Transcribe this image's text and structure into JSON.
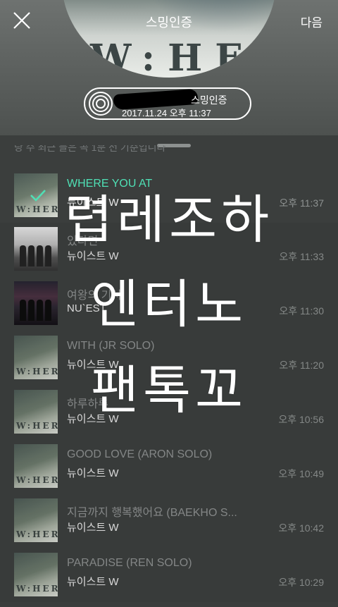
{
  "header": {
    "title": "스밍인증",
    "next_label": "다음",
    "album_art_text": "W:HERE",
    "badge": {
      "label": "스밍인증",
      "timestamp": "2017.11.24 오후 11:37"
    }
  },
  "list": {
    "partial_header_text": "당 수 최근 들은 곡 1분 전 기준입니다",
    "items": [
      {
        "title": "WHERE YOU AT",
        "artist": "뉴이스트 W",
        "time": "오후 11:37",
        "active": true,
        "thumb_text": "W:HERE"
      },
      {
        "title": "있다면",
        "artist": "뉴이스트 W",
        "time": "오후 11:33",
        "active": false,
        "thumb_text": ""
      },
      {
        "title": "여왕의 기사",
        "artist": "NU`EST",
        "time": "오후 11:30",
        "active": false,
        "thumb_text": ""
      },
      {
        "title": "WITH (JR SOLO)",
        "artist": "뉴이스트 W",
        "time": "오후 11:20",
        "active": false,
        "thumb_text": "W:HERE"
      },
      {
        "title": "하루하루",
        "artist": "뉴이스트 W",
        "time": "오후 10:56",
        "active": false,
        "thumb_text": "W:HERE"
      },
      {
        "title": "GOOD LOVE (ARON SOLO)",
        "artist": "뉴이스트 W",
        "time": "오후 10:49",
        "active": false,
        "thumb_text": "W:HERE"
      },
      {
        "title": "지금까지 행복했어요 (BAEKHO S...",
        "artist": "뉴이스트 W",
        "time": "오후 10:42",
        "active": false,
        "thumb_text": "W:HERE"
      },
      {
        "title": "PARADISE (REN SOLO)",
        "artist": "뉴이스트 W",
        "time": "오후 10:29",
        "active": false,
        "thumb_text": "W:HERE"
      }
    ]
  },
  "overlay_text": {
    "line1": "렵레조하",
    "line2": "엔터노",
    "line3": "팬톡꼬"
  },
  "colors": {
    "active_title": "#4fe0b5",
    "background": "#3b3e3d"
  }
}
